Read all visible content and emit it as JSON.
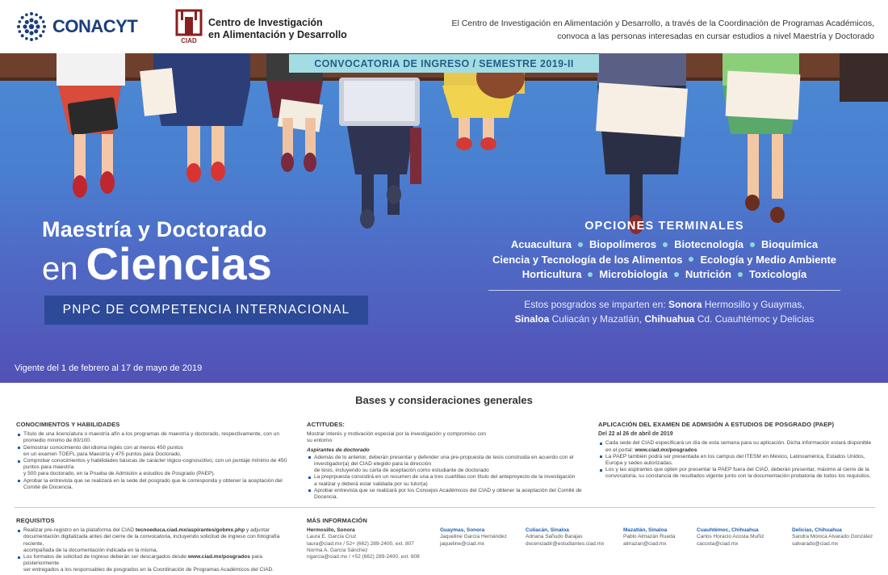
{
  "header": {
    "conacyt_name": "CONACYT",
    "ciad_abbr": "CIAD",
    "ciad_name_1": "Centro de Investigación",
    "ciad_name_2": "en Alimentación y Desarrollo",
    "intro_1": "El Centro de Investigación en Alimentación y Desarrollo, a través de la Coordinación de Programas Académicos,",
    "intro_2": "convoca a las personas interesadas en cursar estudios a nivel Maestría y Doctorado"
  },
  "banner": {
    "convocatoria": "CONVOCATORIA DE INGRESO / SEMESTRE 2019-II",
    "title_1": "Maestría y Doctorado",
    "title_en": "en",
    "title_ciencias": "Ciencias",
    "pnpc": "PNPC DE COMPETENCIA INTERNACIONAL",
    "vigente": "Vigente del 1 de febrero al 17 de mayo de 2019"
  },
  "opciones": {
    "title": "OPCIONES TERMINALES",
    "line1": [
      "Acuacultura",
      "Biopolímeros",
      "Biotecnología",
      "Bioquímica"
    ],
    "line2": [
      "Ciencia y Tecnología de los Alimentos",
      "Ecología y Medio Ambiente"
    ],
    "line3": [
      "Horticultura",
      "Microbiología",
      "Nutrición",
      "Toxicología"
    ],
    "sedes_intro": "Estos posgrados se imparten en:",
    "sonora": "Sonora",
    "sonora_cities": "Hermosillo y Guaymas,",
    "sinaloa": "Sinaloa",
    "sinaloa_cities": "Culiacán y Mazatlán,",
    "chihuahua": "Chihuahua",
    "chihuahua_cities": "Cd. Cuauhtémoc y Delicias"
  },
  "bases": {
    "title": "Bases y consideraciones generales",
    "conocimientos": {
      "heading": "CONOCIMIENTOS Y HABILIDADES",
      "i1a": "Título de una licenciatura o maestría afín a los programas de maestría y doctorado, respectivamente, con un",
      "i1b": "promedio mínimo de 80/100.",
      "i2a": "Demostrar conocimiento del idioma inglés con al menos 450 puntos",
      "i2b": "en un examen TOEFL para Maestría y 475 puntos para Doctorado.",
      "i3a": "Comprobar conocimientos y habilidades básicas de carácter lógico-cognoscitivo, con un puntaje mínimo de 450",
      "i3b": "puntos para maestría",
      "i3c": "y 500 para doctorado, en la Prueba de Admisión a estudios de Posgrado (PAEP).",
      "i4a": "Aprobar la entrevista que se realizará en la sede del posgrado que le corresponda y obtener la aceptación del",
      "i4b": "Comité de Docencia."
    },
    "actitudes": {
      "heading": "ACTITUDES:",
      "p1": "Mostrar interés y motivación especial por la investigación y compromiso con",
      "p2": "su entorno",
      "sub": "Aspirantes de doctorado",
      "i1a": "Además de lo anterior, deberán presentar y defender una pre-propuesta de tesis construida en acuerdo con el",
      "i1b": "investigador(a) del CIAD elegido para la dirección",
      "i1c": "de tesis, incluyendo su carta de aceptación como estudiante de doctorado",
      "i2a": "La preprpuesta consistirá en un resumen de una a tres cuartillas con título del anteproyecto de la investigación",
      "i2b": "a realizar y deberá estar validada por su tutor(a)",
      "i3": "Aprobar entrevista que se realizará por los Consejos Académicos del CIAD y obtener la aceptación del Comité de Docencia."
    },
    "aplicacion": {
      "heading": "APLICACIÓN DEL EXAMEN DE ADMISIÓN A ESTUDIOS DE POSGRADO (PAEP)",
      "date": "Del 22 al 26 de abril de 2019",
      "i1a": "Cada sede del CIAD especificará un día de esta semana para su aplicación. Dicha información estará disponible",
      "i1b": "en el portal:",
      "i1c": "www.ciad.mx/posgrados",
      "i2a": "La PAEP también podrá ser presentada en los campus del ITESM en México, Latinoamérica, Estados Unidos,",
      "i2b": "Europa y sedes autorizadas.",
      "i3a": "Los y las aspirantes que opten por presentar la PAEP fuera del CIAD, deberán presentar, máximo al cierre de la",
      "i3b": "convocatoria, su constancia de resultados vigente junto con la documentación probatoria de todos los requisitos."
    }
  },
  "requisitos": {
    "heading": "REQUISITOS",
    "i1a": "Realizar pre-registro en la plataforma del CIAD",
    "i1b": "tecnoeduca.ciad.mx/aspirantes/gobmx.php",
    "i1c": "y adjuntar",
    "i1d": "documentación digitalizada antes del cierre de la convocatoria, incluyendo solicitud de ingreso con fotografía reciente,",
    "i1e": "acompañada de la documentación indicada en la misma.",
    "i2a": "Los formatos de solicitud de ingreso deberán ser descargados desde",
    "i2b": "www.ciad.mx/posgrados",
    "i2c": "para posteriormente",
    "i2d": "ser entregados a los responsables de posgrados en la Coordinación de Programas Académicos del CIAD."
  },
  "mas_info": {
    "heading": "MÁS INFORMACIÓN",
    "hermosillo": {
      "city": "Hermosillo, Sonora",
      "l1": "Laura E. García Cruz",
      "l2": "laura@ciad.mx / 52+ (662) 289-2400, ext. 807",
      "l3": "Norma A. García Sánchez",
      "l4": "ngarcia@ciad.mx / +52 (662) 289-2400, ext. 808"
    },
    "guaymas": {
      "city": "Guaymas, Sonora",
      "l1": "Jaqueline García Hernández",
      "l2": "jaqueline@ciad.mx"
    },
    "culiacan": {
      "city": "Culiacán, Sinaloa",
      "l1": "Adriana Sañudo Barajas",
      "l2": "docenciadir@estudiantes.ciad.mx"
    },
    "mazatlan": {
      "city": "Mazatlán, Sinaloa",
      "l1": "Pablo Almazán Rueda",
      "l2": "almazan@ciad.mx"
    },
    "cuauhtemoc": {
      "city": "Cuauhtémoc, Chihuahua",
      "l1": "Carlos Horacio Acosta Muñiz",
      "l2": "cacosta@ciad.mx"
    },
    "delicias": {
      "city": "Delicias, Chihuahua",
      "l1": "Sandra Mónica Alvarado González",
      "l2": "salvarado@ciad.mx"
    }
  }
}
